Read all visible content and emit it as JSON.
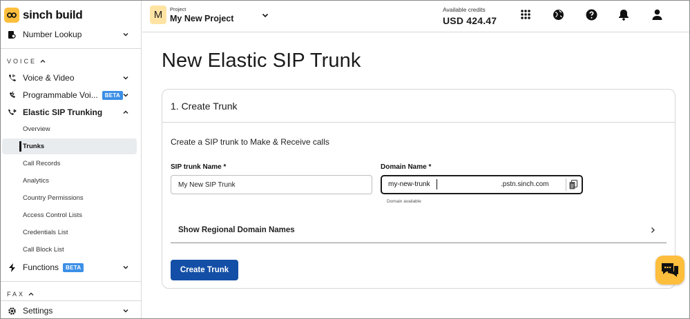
{
  "brand": {
    "logo_text": "sinch build",
    "accent": "#ffbe3c",
    "primary": "#134fa6"
  },
  "sidebar": {
    "number_lookup": "Number Lookup",
    "voice_section": "VOICE",
    "voice_video": "Voice & Video",
    "programmable_voice": "Programmable Voi...",
    "programmable_badge": "BETA",
    "elastic_sip": "Elastic SIP Trunking",
    "sub_items": [
      "Overview",
      "Trunks",
      "Call Records",
      "Analytics",
      "Country Permissions",
      "Access Control Lists",
      "Credentials List",
      "Call Block List"
    ],
    "active_sub_item": "Trunks",
    "functions": "Functions",
    "functions_badge": "BETA",
    "fax_section": "FAX",
    "settings": "Settings"
  },
  "header": {
    "avatar_letter": "M",
    "project_caption": "Project",
    "project_name": "My New Project",
    "credits_caption": "Available credits",
    "credits_value": "USD 424.47",
    "icons": [
      "apps-grid-icon",
      "globe-icon",
      "help-icon",
      "bell-icon",
      "account-icon"
    ]
  },
  "main": {
    "title": "New Elastic SIP Trunk",
    "card_title": "1. Create Trunk",
    "description": "Create a SIP trunk to Make & Receive calls",
    "sip_label": "SIP trunk Name *",
    "sip_value": "My New SIP Trunk",
    "domain_label": "Domain Name *",
    "domain_value": "my-new-trunk",
    "domain_suffix": ".pstn.sinch.com",
    "domain_hint": "Domain available",
    "regional_label": "Show Regional Domain Names",
    "submit_label": "Create Trunk"
  }
}
